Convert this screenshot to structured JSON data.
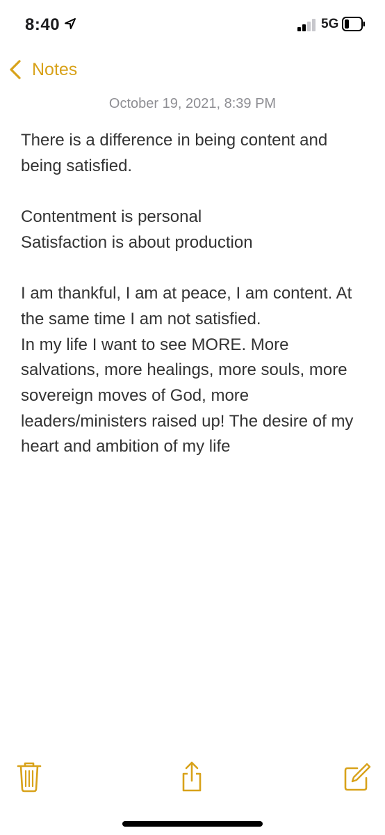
{
  "status_bar": {
    "time": "8:40",
    "network": "5G",
    "location_icon": "location-arrow-icon",
    "signal_icon": "signal-bars-icon",
    "battery_icon": "battery-icon"
  },
  "nav": {
    "back_label": "Notes",
    "back_icon": "chevron-left-icon"
  },
  "note": {
    "date": "October 19, 2021, 8:39 PM",
    "lines": [
      "There is a difference in being content and being satisfied.",
      "",
      "Contentment is personal",
      "Satisfaction is about production",
      "",
      "I am thankful, I am at peace, I am content. At the same time I am not satisfied.",
      "In my life I want to see MORE. More salvations, more healings, more souls, more sovereign moves of God, more leaders/ministers raised up! The desire of my heart and ambition of my life"
    ]
  },
  "toolbar": {
    "items": [
      "trash-icon",
      "share-icon",
      "compose-icon"
    ]
  },
  "colors": {
    "accent": "#d8a21a",
    "date": "#8e8e93",
    "body_text": "#333333"
  }
}
